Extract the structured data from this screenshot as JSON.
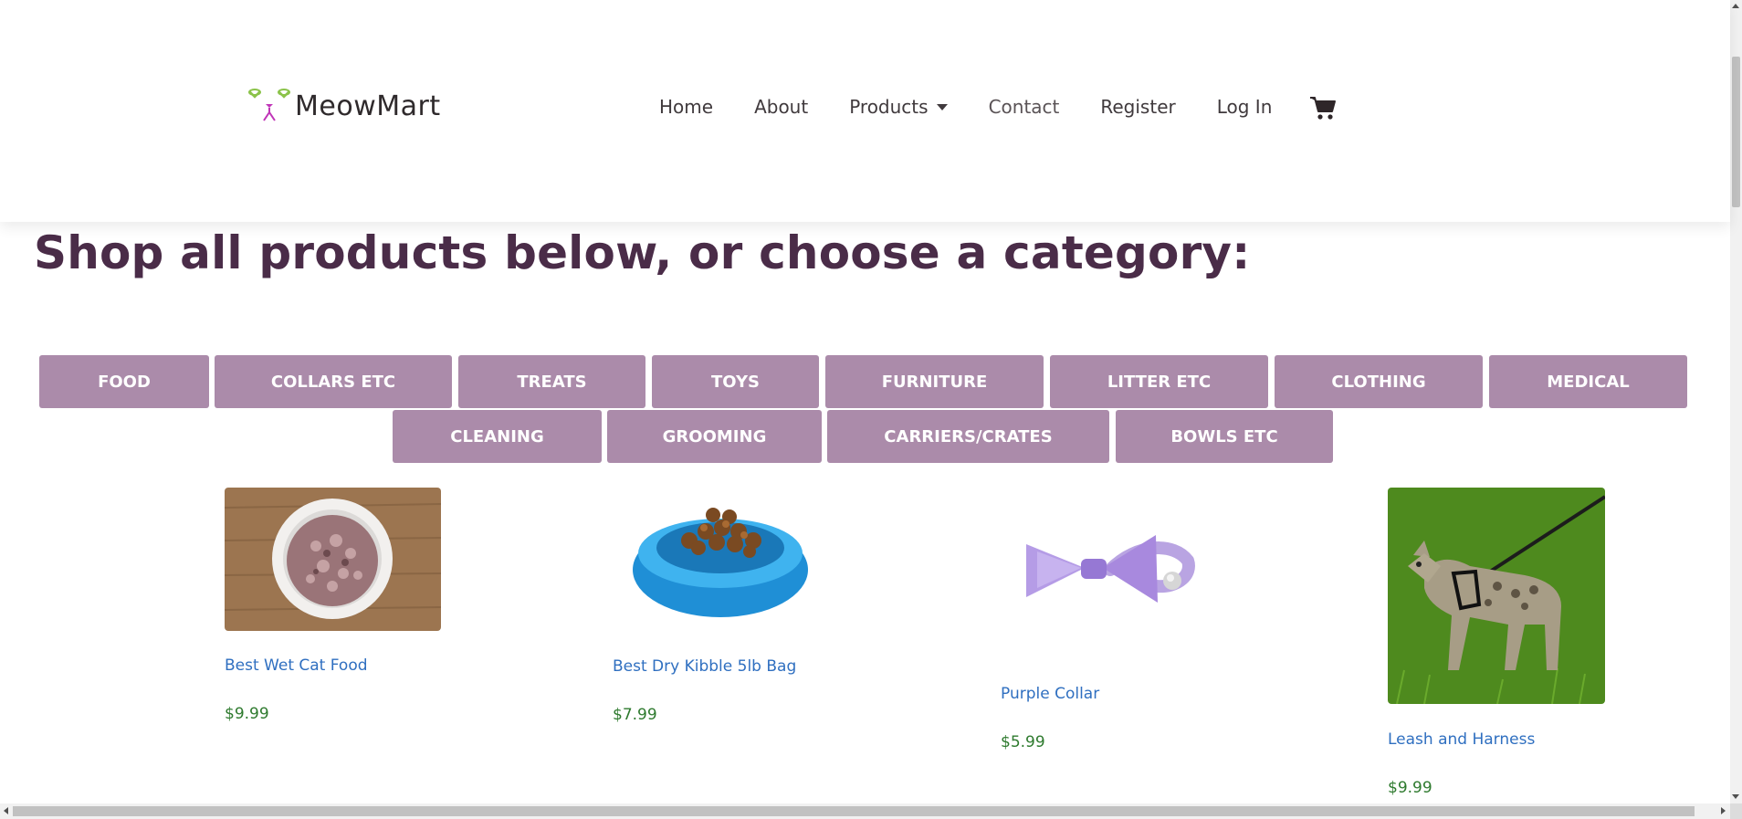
{
  "brand": {
    "name": "MeowMart"
  },
  "nav": {
    "items": [
      "Home",
      "About",
      "Products",
      "Contact",
      "Register",
      "Log In"
    ]
  },
  "page": {
    "title": "Shop all products below, or choose a category:"
  },
  "categories": [
    "FOOD",
    "COLLARS ETC",
    "TREATS",
    "TOYS",
    "FURNITURE",
    "LITTER ETC",
    "CLOTHING",
    "MEDICAL",
    "CLEANING",
    "GROOMING",
    "CARRIERS/CRATES",
    "BOWLS ETC"
  ],
  "products": [
    {
      "name": "Best Wet Cat Food",
      "price": "$9.99",
      "image": "wet-food-bowl"
    },
    {
      "name": "Best Dry Kibble 5lb Bag",
      "price": "$7.99",
      "image": "kibble-blue-bowl"
    },
    {
      "name": "Purple Collar",
      "price": "$5.99",
      "image": "purple-bow-collar"
    },
    {
      "name": "Leash and Harness",
      "price": "$9.99",
      "image": "cat-on-leash"
    }
  ],
  "icons": {
    "cart": "shopping-cart-icon",
    "dropdown": "chevron-down-icon",
    "logo": "cat-face-icon"
  },
  "colors": {
    "brand_purple": "#4a2c48",
    "category_button": "#ab8baa",
    "link": "#2f6fc0",
    "price": "#2e7a2e"
  }
}
